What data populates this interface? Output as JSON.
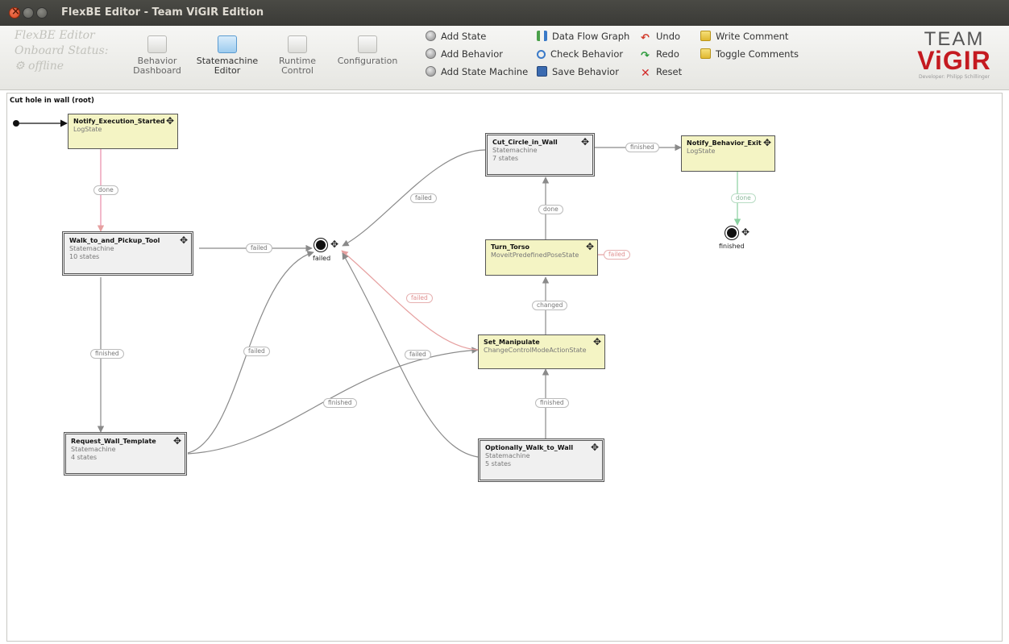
{
  "window": {
    "title": "FlexBE Editor - Team ViGIR Edition"
  },
  "status": {
    "app_name": "FlexBE Editor",
    "onboard_label": "Onboard Status:",
    "connection": "offline"
  },
  "nav": [
    {
      "label_line1": "Behavior",
      "label_line2": "Dashboard",
      "icon": "dashboard-icon"
    },
    {
      "label_line1": "Statemachine",
      "label_line2": "Editor",
      "icon": "statemachine-icon"
    },
    {
      "label_line1": "Runtime",
      "label_line2": "Control",
      "icon": "runtime-icon"
    },
    {
      "label_line1": "Configuration",
      "label_line2": "",
      "icon": "configuration-icon"
    }
  ],
  "actions": {
    "add_state": "Add State",
    "add_behavior": "Add Behavior",
    "add_state_machine": "Add State Machine",
    "data_flow_graph": "Data Flow Graph",
    "check_behavior": "Check Behavior",
    "save_behavior": "Save Behavior",
    "undo": "Undo",
    "redo": "Redo",
    "reset": "Reset",
    "write_comment": "Write Comment",
    "toggle_comments": "Toggle Comments"
  },
  "logo": {
    "line1": "TEAM",
    "line2": "ViGIR",
    "tagline": "Developer: Philipp Schillinger"
  },
  "canvas": {
    "title": "Cut hole in wall (root)"
  },
  "states": {
    "notify_started": {
      "name": "Notify_Execution_Started",
      "type": "LogState"
    },
    "walk_pickup": {
      "name": "Walk_to_and_Pickup_Tool",
      "type": "Statemachine",
      "count": "10 states"
    },
    "request_wall": {
      "name": "Request_Wall_Template",
      "type": "Statemachine",
      "count": "4 states"
    },
    "cut_circle": {
      "name": "Cut_Circle_in_Wall",
      "type": "Statemachine",
      "count": "7 states"
    },
    "turn_torso": {
      "name": "Turn_Torso",
      "type": "MoveitPredefinedPoseState"
    },
    "set_manipulate": {
      "name": "Set_Manipulate",
      "type": "ChangeControlModeActionState"
    },
    "optionally_walk": {
      "name": "Optionally_Walk_to_Wall",
      "type": "Statemachine",
      "count": "5 states"
    },
    "notify_exit": {
      "name": "Notify_Behavior_Exit",
      "type": "LogState"
    }
  },
  "outcomes": {
    "failed": "failed",
    "finished": "finished"
  },
  "edge_labels": {
    "done": "done",
    "failed": "failed",
    "finished": "finished",
    "changed": "changed"
  },
  "colors": {
    "leaf_state_fill": "#f4f4c4",
    "container_fill": "#f0f0f0",
    "edge_default": "#8a8a8a",
    "edge_failed_red": "#e6a0a0",
    "edge_done_pink": "#e88aa8",
    "edge_done_green": "#8ad0a0",
    "logo_red": "#c41a20"
  }
}
